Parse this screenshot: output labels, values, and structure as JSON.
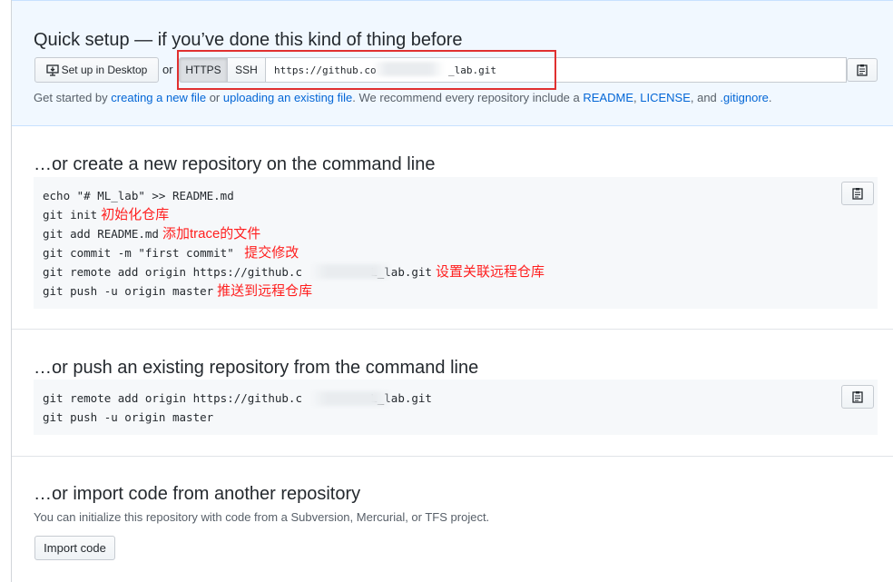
{
  "quick_setup": {
    "title": "Quick setup — if you’ve done this kind of thing before",
    "setup_desktop_label": "Set up in Desktop",
    "or_text": "or",
    "https_label": "HTTPS",
    "ssh_label": "SSH",
    "url_value": "https://github.co            _lab.git",
    "help": {
      "prefix": "Get started by",
      "creating_link": "creating a new file",
      "or": "or",
      "uploading_link": "uploading an existing file",
      "middle": ". We recommend every repository include a",
      "readme": "README",
      "license": "LICENSE",
      "and": ", and",
      "gitignore": ".gitignore",
      "end": "."
    }
  },
  "new_repo": {
    "title": "…or create a new repository on the command line",
    "lines": [
      {
        "code": "echo \"# ML_lab\" >> README.md",
        "note": ""
      },
      {
        "code": "git init",
        "note": "初始化仓库"
      },
      {
        "code": "git add README.md",
        "note": "添加trace的文件"
      },
      {
        "code": "git commit -m \"first commit\" ",
        "note": "提交修改"
      },
      {
        "code": "git remote add origin https://github.c          L_lab.git",
        "note": "设置关联远程仓库"
      },
      {
        "code": "git push -u origin master",
        "note": "推送到远程仓库"
      }
    ]
  },
  "push_repo": {
    "title": "…or push an existing repository from the command line",
    "lines": [
      "git remote add origin https://github.c          L_lab.git",
      "git push -u origin master"
    ]
  },
  "import_repo": {
    "title": "…or import code from another repository",
    "description": "You can initialize this repository with code from a Subversion, Mercurial, or TFS project.",
    "button_label": "Import code"
  },
  "colors": {
    "annotation_red": "#ff1f1f",
    "link_blue": "#0366d6",
    "quick_bg": "#f1f8ff"
  },
  "icons": {
    "desktop": "desktop-download-icon",
    "clipboard": "clipboard-icon"
  }
}
